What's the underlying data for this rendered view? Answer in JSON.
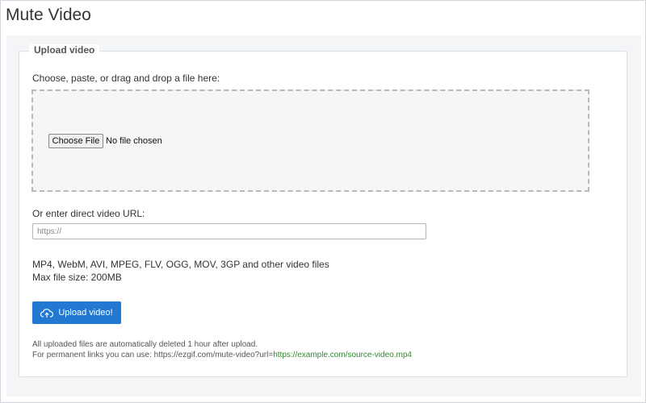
{
  "page": {
    "title": "Mute Video"
  },
  "upload": {
    "legend": "Upload video",
    "choose_label": "Choose, paste, or drag and drop a file here:",
    "file_button": "Choose File",
    "file_status": "No file chosen",
    "url_label": "Or enter direct video URL:",
    "url_placeholder": "https://",
    "url_value": "",
    "formats": "MP4, WebM, AVI, MPEG, FLV, OGG, MOV, 3GP and other video files",
    "max_size": "Max file size: 200MB",
    "upload_button": "Upload video!"
  },
  "notes": {
    "line1": "All uploaded files are automatically deleted 1 hour after upload.",
    "line2_prefix": "For permanent links you can use: https://ezgif.com/mute-video?url=",
    "line2_link": "https://example.com/source-video.mp4"
  },
  "colors": {
    "accent": "#2379d2",
    "link": "#2e8b2e"
  },
  "icons": {
    "upload_button_icon": "cloud-upload-icon"
  }
}
